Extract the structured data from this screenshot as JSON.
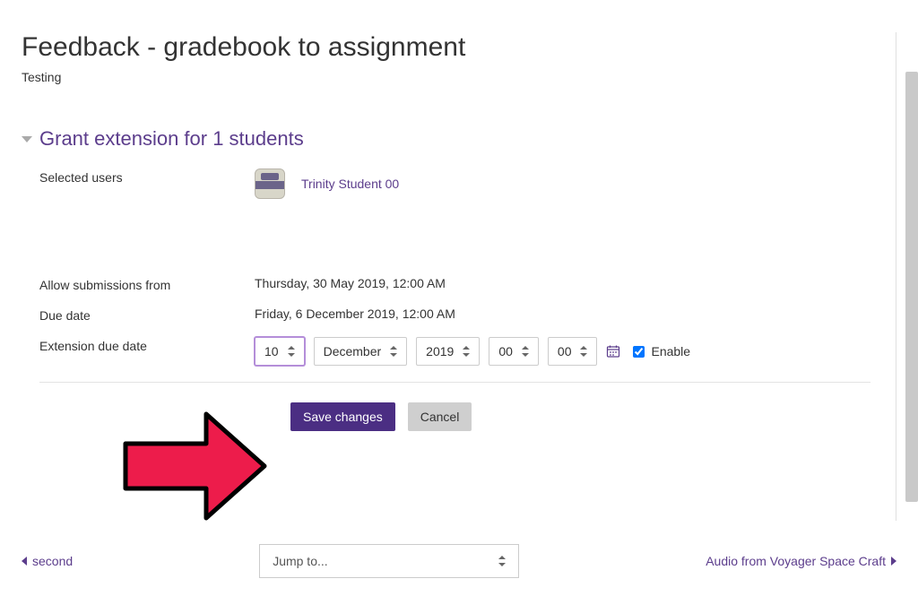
{
  "page_title": "Feedback - gradebook to assignment",
  "subtitle": "Testing",
  "section_title": "Grant extension for 1 students",
  "labels": {
    "selected_users": "Selected users",
    "allow_from": "Allow submissions from",
    "due_date": "Due date",
    "extension_due": "Extension due date",
    "enable": "Enable"
  },
  "selected_user": {
    "name": "Trinity Student 00"
  },
  "dates": {
    "allow_from": "Thursday, 30 May 2019, 12:00 AM",
    "due": "Friday, 6 December 2019, 12:00 AM"
  },
  "extension": {
    "day": "10",
    "month": "December",
    "year": "2019",
    "hour": "00",
    "minute": "00",
    "enabled": true
  },
  "buttons": {
    "save": "Save changes",
    "cancel": "Cancel"
  },
  "footer": {
    "prev": "second",
    "next": "Audio from Voyager Space Craft",
    "jump_placeholder": "Jump to..."
  },
  "colors": {
    "brand": "#5C3D8C",
    "primary_btn": "#4B2E83",
    "annotation": "#ED1C4B"
  }
}
